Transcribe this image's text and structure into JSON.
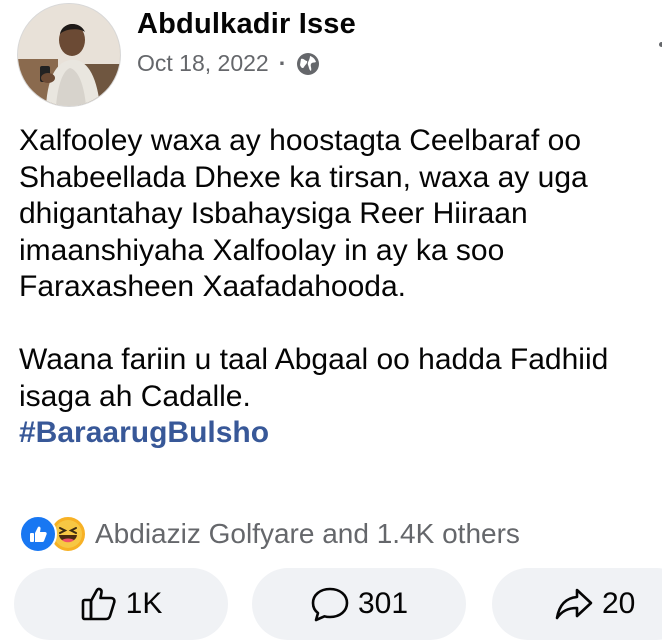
{
  "post": {
    "author": "Abdulkadir Isse",
    "date": "Oct 18, 2022",
    "separator": "·",
    "lines_p1": [
      "Xalfooley waxa ay hoostagta Ceelbaraf oo",
      "Shabeellada Dhexe ka tirsan, waxa ay uga",
      "dhigantahay Isbahaysiga Reer Hiiraan",
      "imaanshiyaha Xalfoolay in ay ka soo",
      "Faraxasheen Xaafadahooda."
    ],
    "lines_p2": [
      "Waana fariin u taal Abgaal oo hadda Fadhiid",
      "isaga ah Cadalle."
    ],
    "hashtag": "#BaraarugBulsho"
  },
  "reactions": {
    "summary": "Abdiaziz Golfyare and 1.4K others",
    "icons": [
      "like-reaction-icon",
      "haha-reaction-icon"
    ]
  },
  "actions": {
    "like_count": "1K",
    "comment_count": "301",
    "share_count": "20"
  },
  "colors": {
    "hashtag": "#385898",
    "meta_gray": "#65676b",
    "like_blue": "#1877f2",
    "haha_yellow": "#f7b125",
    "button_bg": "#f0f2f5"
  }
}
